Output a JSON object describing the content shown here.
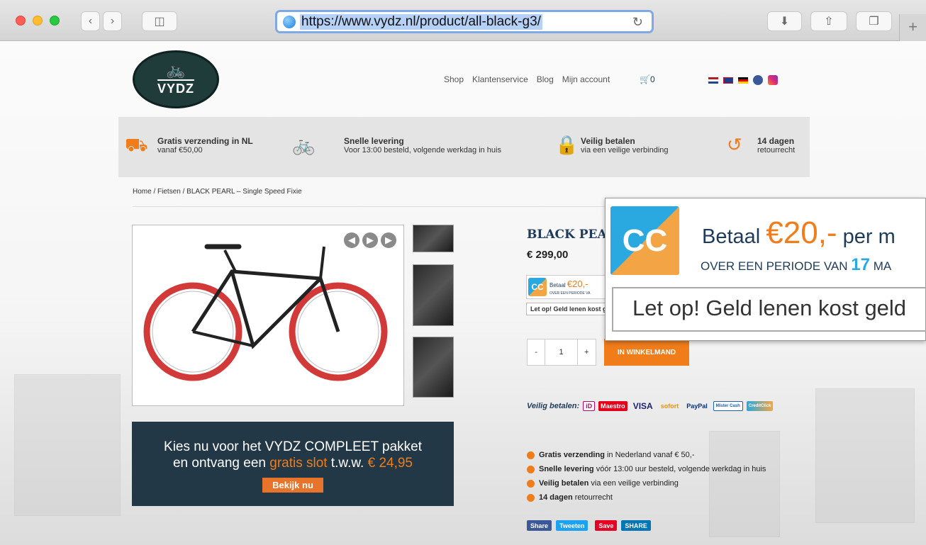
{
  "browser": {
    "url": "https://www.vydz.nl/product/all-black-g3/",
    "new_tab": "+"
  },
  "logo": {
    "text": "VYDZ"
  },
  "nav": {
    "items": [
      "Shop",
      "Klantenservice",
      "Blog",
      "Mijn account"
    ],
    "cart": "0"
  },
  "usp": [
    {
      "title": "Gratis verzending in NL",
      "sub": "vanaf €50,00",
      "icon": "truck-icon"
    },
    {
      "title": "Snelle levering",
      "sub": "Voor 13:00 besteld, volgende werkdag in huis",
      "icon": "bike-icon"
    },
    {
      "title": "Veilig betalen",
      "sub": "via een veilige verbinding",
      "icon": "lock-icon"
    },
    {
      "title": "14 dagen",
      "sub": "retourrecht",
      "icon": "return-icon"
    }
  ],
  "breadcrumb": {
    "home": "Home",
    "cat": "Fietsen",
    "current": "BLACK PEARL – Single Speed Fixie"
  },
  "banner": {
    "line1": "Kies nu voor het VYDZ COMPLEET pakket",
    "line2a": "en ontvang een ",
    "line2b": "gratis slot",
    "line2c": " t.w.w. ",
    "line2d": "€ 24,95",
    "button": "Bekijk nu"
  },
  "product": {
    "title": "BLACK PEA",
    "price": "€ 299,00",
    "qty": "1",
    "minus": "-",
    "plus": "+",
    "add_to_cart": "IN WINKELMAND"
  },
  "credit": {
    "pay_label": "Betaal",
    "amount": "€20,-",
    "per": "per m",
    "period_label": "OVER EEN PERIODE VAN",
    "months": "17",
    "months_suffix": "MA",
    "warning": "Let op! Geld lenen kost geld",
    "warning_small": "Let op! Geld lenen kost geld",
    "cc": "CC",
    "small_pay": "Betaal",
    "small_amount": "€20,-",
    "small_period": "OVER EEN PERIODE VA"
  },
  "payment": {
    "label": "Veilig betalen:",
    "methods": [
      "iD",
      "Maestro",
      "VISA",
      "sofort",
      "PayPal",
      "Mister Cash",
      "CreditClick"
    ]
  },
  "bullets": [
    {
      "bold": "Gratis verzending",
      "rest": " in Nederland vanaf € 50,-"
    },
    {
      "bold": "Snelle levering",
      "rest": " vóór 13:00 uur besteld, volgende werkdag in huis"
    },
    {
      "bold": "Veilig betalen",
      "rest": " via een veilige verbinding"
    },
    {
      "bold": "14 dagen",
      "rest": " retourrecht"
    }
  ],
  "share": {
    "facebook": "Share",
    "twitter": "Tweeten",
    "pinterest": "Save",
    "linkedin": "SHARE"
  }
}
